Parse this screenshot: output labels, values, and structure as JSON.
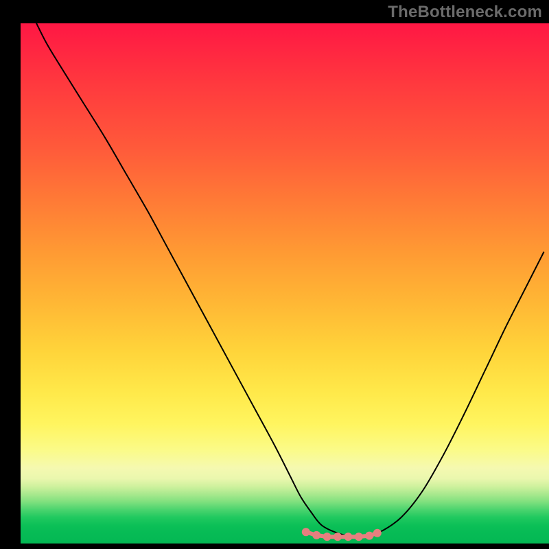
{
  "watermark": "TheBottleneck.com",
  "colors": {
    "background": "#000000",
    "watermark_text": "#6b6b6b",
    "curve_stroke": "#000000",
    "plateau_marker": "#e77f7f",
    "gradient_top": "#ff1744",
    "gradient_bottom": "#04b854"
  },
  "chart_data": {
    "type": "line",
    "title": "",
    "xlabel": "",
    "ylabel": "",
    "xlim": [
      0,
      100
    ],
    "ylim": [
      0,
      100
    ],
    "grid": false,
    "legend": false,
    "series": [
      {
        "name": "bottleneck-curve",
        "x": [
          3,
          5,
          8,
          12,
          16,
          20,
          24,
          28,
          32,
          36,
          40,
          44,
          48,
          51,
          53,
          55,
          57,
          60,
          63,
          65,
          68,
          72,
          76,
          80,
          84,
          88,
          92,
          96,
          99
        ],
        "y": [
          100,
          96,
          91,
          84.5,
          78,
          71,
          64,
          56.5,
          49,
          41.5,
          34,
          26.5,
          19,
          13,
          9,
          6,
          3.5,
          2,
          1.3,
          1.3,
          2.2,
          5,
          10,
          17,
          25,
          33.5,
          42,
          50,
          56
        ],
        "note": "V-shaped curve; y is visual height as percentage of plot area (0 = bottom green, 100 = top red). Minimum plateau roughly between x≈58 and x≈66 at y≈1.3."
      },
      {
        "name": "plateau-marker",
        "x": [
          54,
          56,
          58,
          60,
          62,
          64,
          66,
          67.5
        ],
        "y": [
          2.2,
          1.6,
          1.3,
          1.3,
          1.3,
          1.3,
          1.5,
          2.0
        ],
        "style": "dots",
        "radius_px": 6,
        "color": "#e77f7f"
      }
    ],
    "background_gradient": {
      "orientation": "vertical",
      "stops": [
        {
          "pct": 0,
          "color": "#ff1744"
        },
        {
          "pct": 24,
          "color": "#ff5a3a"
        },
        {
          "pct": 44,
          "color": "#ff9a33"
        },
        {
          "pct": 63,
          "color": "#ffd43a"
        },
        {
          "pct": 77,
          "color": "#fff55f"
        },
        {
          "pct": 85,
          "color": "#f5f9b0"
        },
        {
          "pct": 90,
          "color": "#a9e98e"
        },
        {
          "pct": 95,
          "color": "#20c95f"
        },
        {
          "pct": 100,
          "color": "#04b854"
        }
      ]
    }
  }
}
